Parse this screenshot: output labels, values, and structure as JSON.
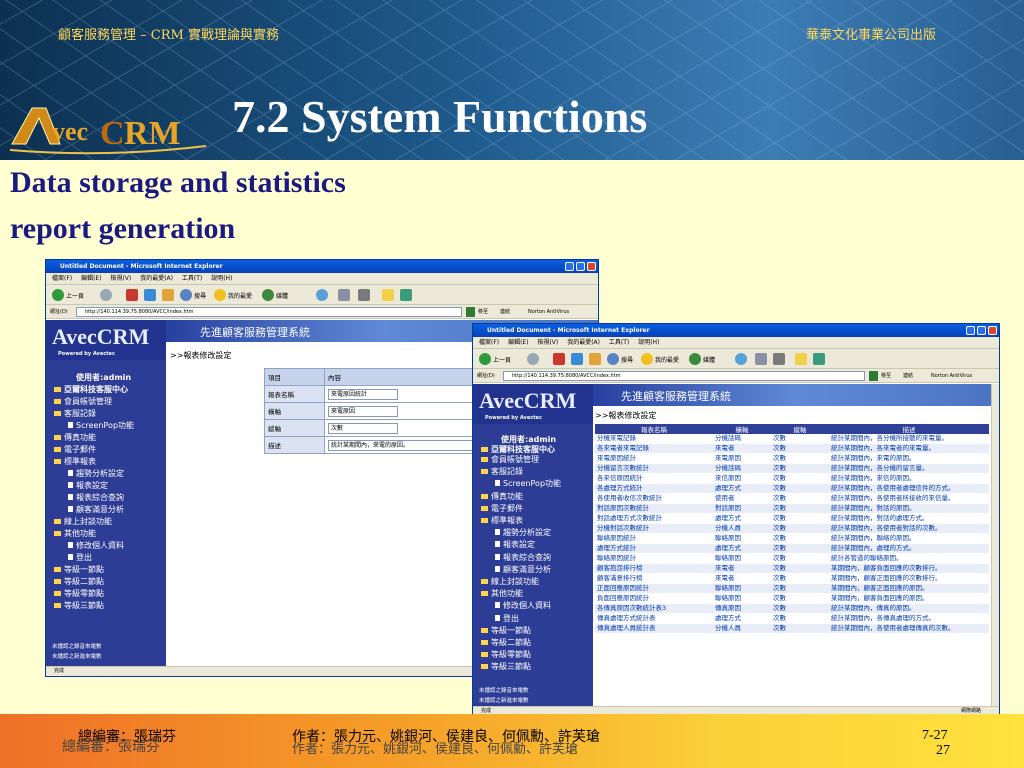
{
  "slide": {
    "top_left": "顧客服務管理 – CRM 實戰理論與實務",
    "top_right": "華泰文化事業公司出版",
    "logo_text": "AvecCRM",
    "title": "7.2 System Functions",
    "subtitle_line1": "Data storage and statistics",
    "subtitle_line2": "report generation",
    "footer_editor": "總編審：張瑞芬",
    "footer_authors": "作者：張力元、姚銀河、侯建良、何佩勳、許芙瑲",
    "page_label": "7-27",
    "page_number": "27"
  },
  "browser": {
    "title": "Untitled Document - Microsoft Internet Explorer",
    "menu": [
      "檔案(F)",
      "編輯(E)",
      "檢視(V)",
      "我的最愛(A)",
      "工具(T)",
      "說明(H)"
    ],
    "back_label": "上一頁",
    "search_label": "搜尋",
    "favorites_label": "我的最愛",
    "media_label": "媒體",
    "address_label": "網址(D)",
    "go_label": "移至",
    "links_label": "連結",
    "norton": "Norton AntiVirus",
    "status_done": "完成",
    "status_zone": "網際網路",
    "site_logo": "AvecCRM",
    "site_logo_sub": "Powered by Avectec",
    "site_banner": "先進顧客服務管理系統"
  },
  "window_a": {
    "address": "http://140.114.39.75:8080/AVCC/index.htm",
    "breadcrumb": ">>報表修改設定",
    "user": "使用者:admin",
    "center": "亞爾科技客服中心",
    "nav": [
      {
        "label": "會員帳號管理",
        "level": 1
      },
      {
        "label": "客服記錄",
        "level": 1
      },
      {
        "label": "ScreenPop功能",
        "level": 2
      },
      {
        "label": "傳真功能",
        "level": 1
      },
      {
        "label": "電子郵件",
        "level": 1
      },
      {
        "label": "標準報表",
        "level": 1
      },
      {
        "label": "趨勢分析設定",
        "level": 2
      },
      {
        "label": "報表設定",
        "level": 2
      },
      {
        "label": "報表綜合查詢",
        "level": 2
      },
      {
        "label": "顧客滿意分析",
        "level": 2
      },
      {
        "label": "線上封談功能",
        "level": 1
      },
      {
        "label": "其他功能",
        "level": 1
      },
      {
        "label": "修改個人資料",
        "level": 2
      },
      {
        "label": "登出",
        "level": 2
      },
      {
        "label": "等級一節點",
        "level": 1
      },
      {
        "label": "等級二節點",
        "level": 1
      },
      {
        "label": "等級零節點",
        "level": 1
      },
      {
        "label": "等級三節點",
        "level": 1
      }
    ],
    "bottom_notes": [
      "未播認之錄音來電數",
      "未播認之新進來電數"
    ],
    "form_headers": [
      "項目",
      "內容"
    ],
    "form_rows": [
      {
        "label": "報表名稱",
        "value": "來電原因統計"
      },
      {
        "label": "橫軸",
        "value": "來電原因"
      },
      {
        "label": "縱軸",
        "value": "次數"
      },
      {
        "label": "描述",
        "value": "統計某期間內，來電的原因。"
      }
    ]
  },
  "window_b": {
    "address": "http://140.114.39.75:8080/AVCC/index.htm",
    "breadcrumb": ">>報表修改設定",
    "user": "使用者:admin",
    "center": "亞爾科技客服中心",
    "nav": [
      {
        "label": "會員帳號管理",
        "level": 1
      },
      {
        "label": "客服記錄",
        "level": 1
      },
      {
        "label": "ScreenPop功能",
        "level": 2
      },
      {
        "label": "傳真功能",
        "level": 1
      },
      {
        "label": "電子郵件",
        "level": 1
      },
      {
        "label": "標準報表",
        "level": 1
      },
      {
        "label": "趨勢分析設定",
        "level": 2
      },
      {
        "label": "報表設定",
        "level": 2
      },
      {
        "label": "報表綜合查詢",
        "level": 2
      },
      {
        "label": "顧客滿意分析",
        "level": 2
      },
      {
        "label": "線上封談功能",
        "level": 1
      },
      {
        "label": "其他功能",
        "level": 1
      },
      {
        "label": "修改個人資料",
        "level": 2
      },
      {
        "label": "登出",
        "level": 2
      },
      {
        "label": "等級一節點",
        "level": 1
      },
      {
        "label": "等級二節點",
        "level": 1
      },
      {
        "label": "等級零節點",
        "level": 1
      },
      {
        "label": "等級三節點",
        "level": 1
      }
    ],
    "bottom_notes": [
      "未播認之錄音來電數",
      "未播認之新進來電數"
    ],
    "table_headers": [
      "報表名稱",
      "橫軸",
      "縱軸",
      "描述"
    ],
    "rows": [
      [
        "分機來電記錄",
        "分機話碼",
        "次數",
        "統計某期間內，各分機所接聽的來電量。"
      ],
      [
        "各來電者來電記錄",
        "來電者",
        "次數",
        "統計某期間內，各來電者的來電量。"
      ],
      [
        "來電原因統計",
        "來電原因",
        "次數",
        "統計某期間內，來電的原因。"
      ],
      [
        "分機留言次數統計",
        "分機話碼",
        "次數",
        "統計某期間內，各分機的留言量。"
      ],
      [
        "各來信原因統計",
        "來信原因",
        "次數",
        "統計某期間內，來信的原因。"
      ],
      [
        "各處理方式統計",
        "處理方式",
        "次數",
        "統計某期間內，各使用者處理信件的方式。"
      ],
      [
        "各使用者收信次數統計",
        "使用者",
        "次數",
        "統計某期間內，各使用者所接收的來信量。"
      ],
      [
        "對話原因次數統計",
        "對話原因",
        "次數",
        "統計某期間內，對話的原因。"
      ],
      [
        "對話處理方式次數統計",
        "處理方式",
        "次數",
        "統計某期間內，對話的處理方式。"
      ],
      [
        "分機對話次數統計",
        "分機人員",
        "次數",
        "統計某期間內，各使用者對話的次數。"
      ],
      [
        "聯絡原因統計",
        "聯絡原因",
        "次數",
        "統計某期間內，聯絡的原因。"
      ],
      [
        "處理方式統計",
        "處理方式",
        "次數",
        "統計某期間內，處理的方式。"
      ],
      [
        "聯絡原因統計",
        "聯絡原因",
        "次數",
        "統計各管道的聯絡原因。"
      ],
      [
        "顧客抱怨排行榜",
        "來電者",
        "次數",
        "某期間內，顧客負面回應的次數排行。"
      ],
      [
        "顧客滿意排行榜",
        "來電者",
        "次數",
        "某期間內，顧客正面回應的次數排行。"
      ],
      [
        "正面回應原因統計",
        "聯絡原因",
        "次數",
        "某期間內，顧客正面回應的原因。"
      ],
      [
        "負面回應原因統計",
        "聯絡原因",
        "次數",
        "某期間內，顧客負面回應的原因。"
      ],
      [
        "各傳真原因次數統計表3",
        "傳真原因",
        "次數",
        "統計某期間內，傳真的原因。"
      ],
      [
        "傳真處理方式統計表",
        "處理方式",
        "次數",
        "統計某期間內，各傳真處理的方式。"
      ],
      [
        "傳真處理人員統計表",
        "分機人員",
        "次數",
        "統計某期間內，各使用者處理傳真的次數。"
      ]
    ]
  }
}
